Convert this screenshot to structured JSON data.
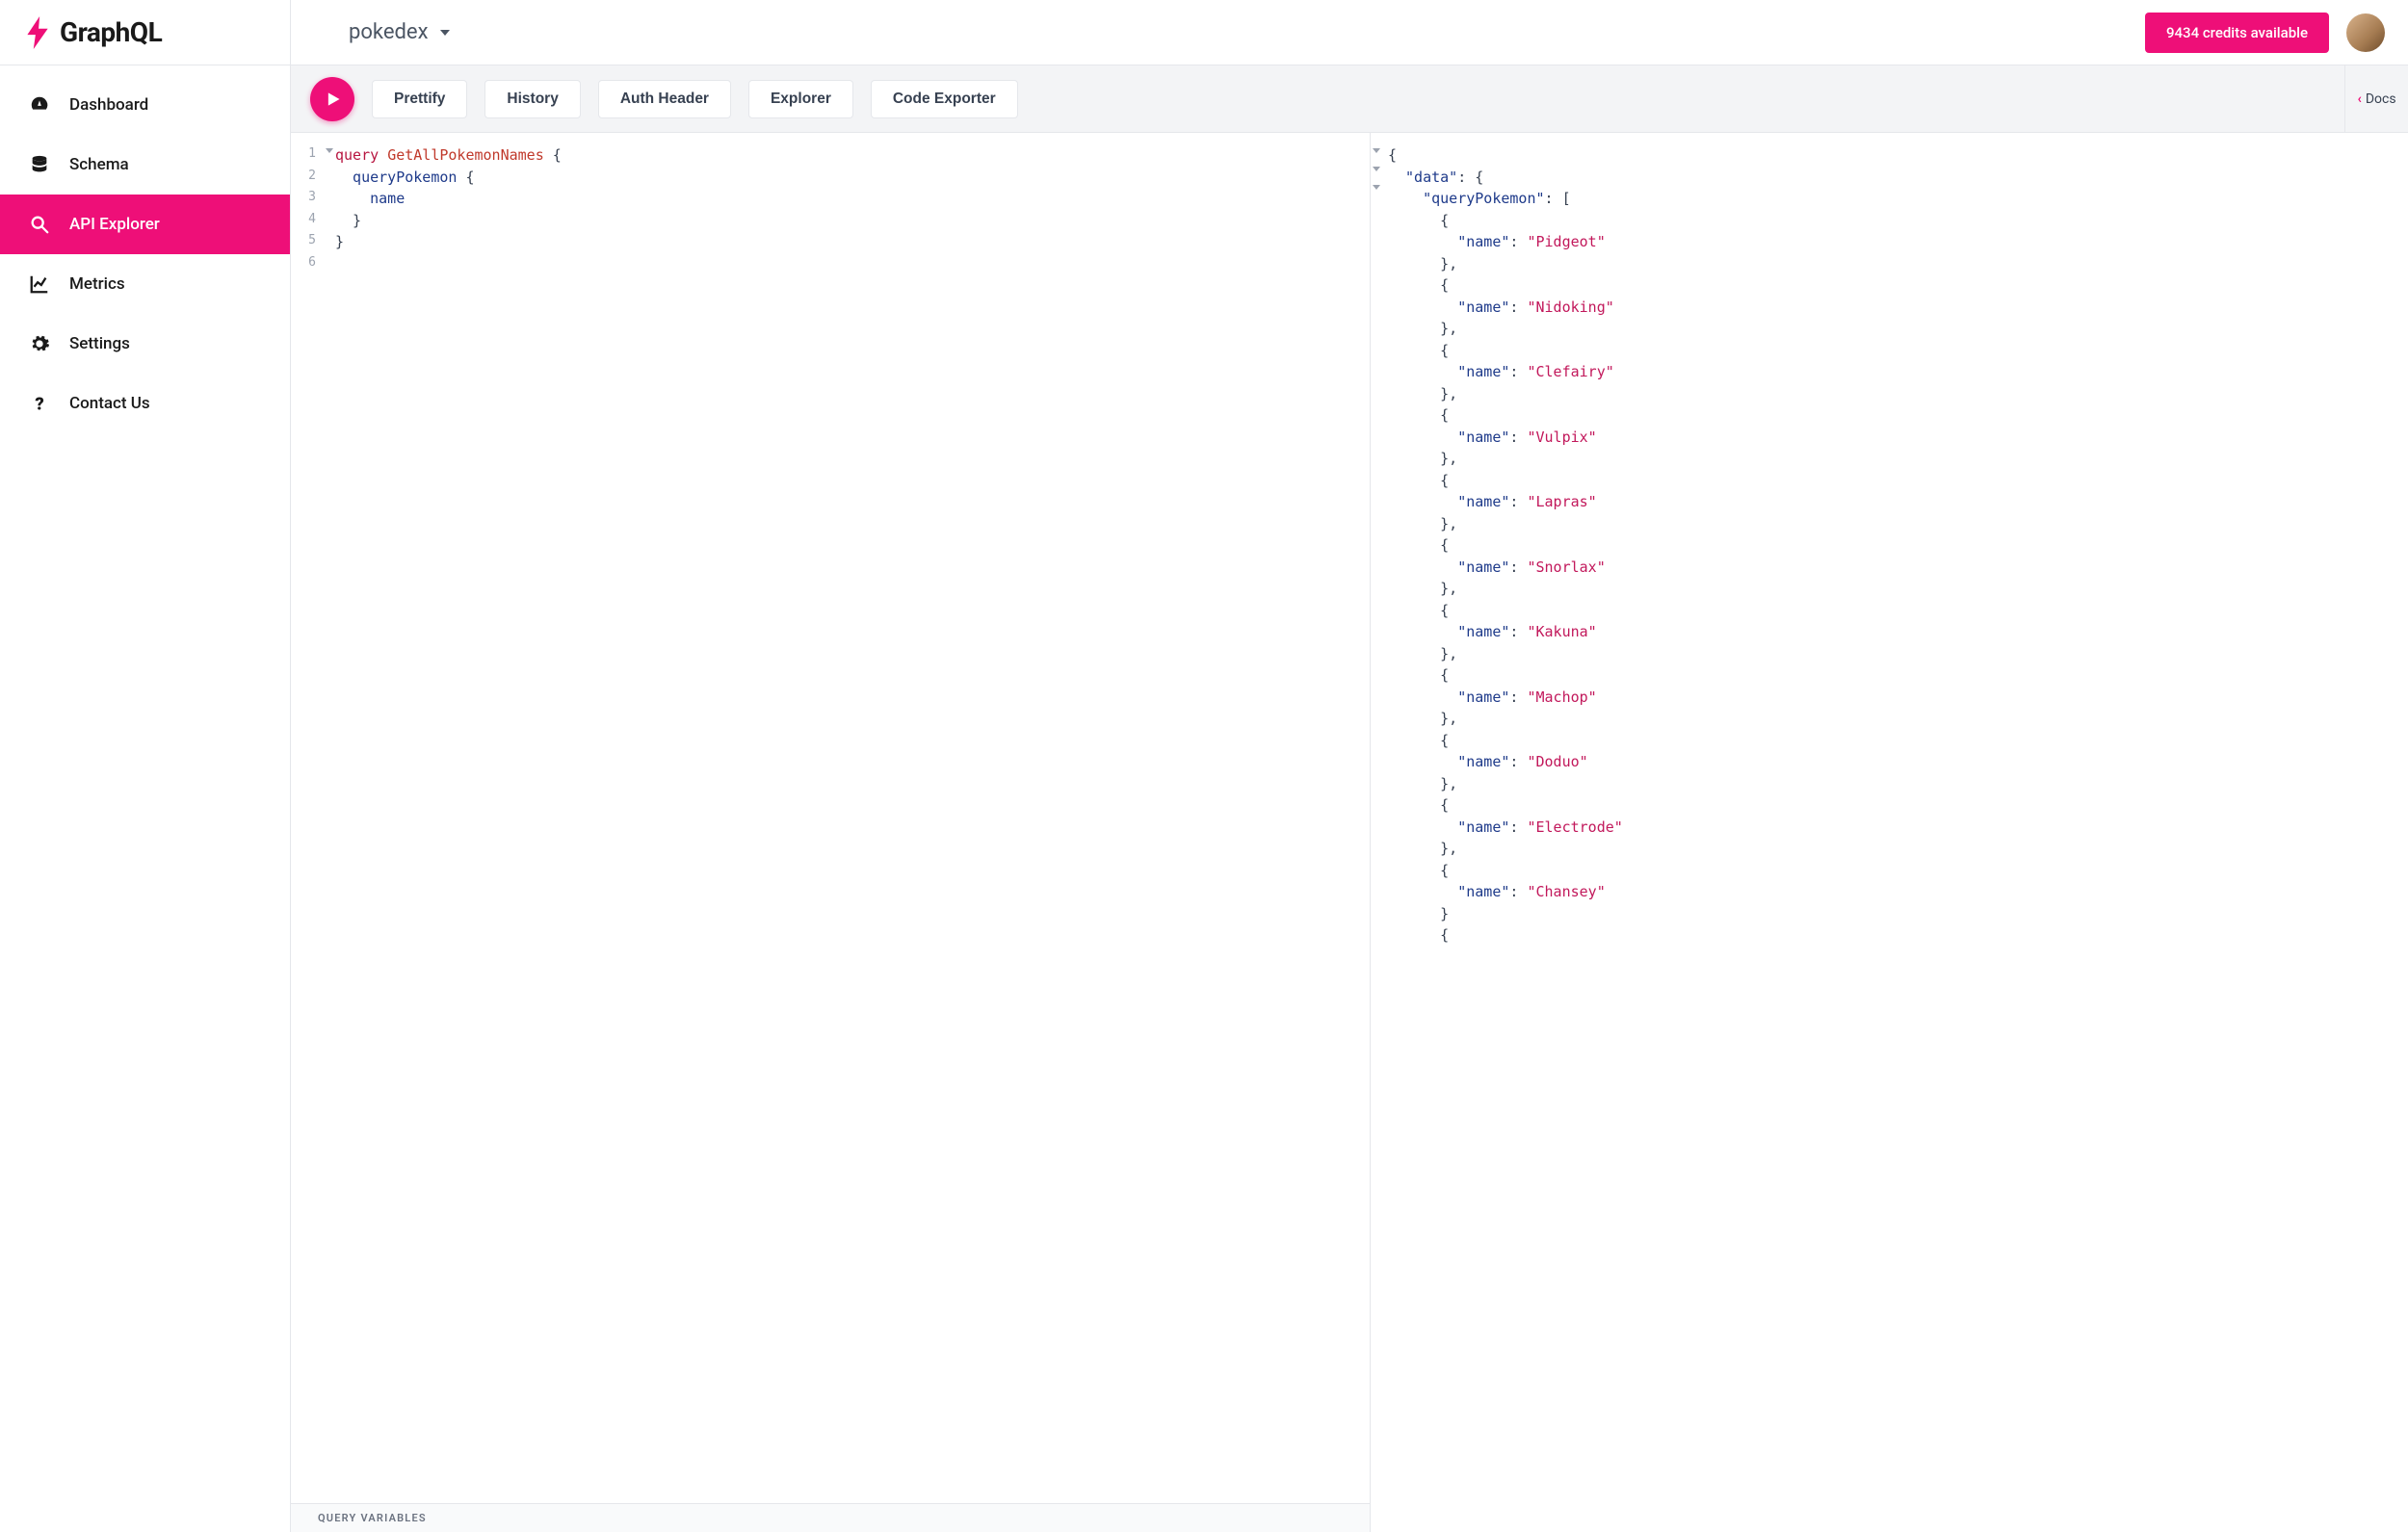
{
  "brand": "GraphQL",
  "sidebar": {
    "items": [
      {
        "label": "Dashboard",
        "icon": "dashboard-icon"
      },
      {
        "label": "Schema",
        "icon": "database-icon"
      },
      {
        "label": "API Explorer",
        "icon": "search-icon",
        "active": true
      },
      {
        "label": "Metrics",
        "icon": "chart-icon"
      },
      {
        "label": "Settings",
        "icon": "gears-icon"
      },
      {
        "label": "Contact Us",
        "icon": "help-icon"
      }
    ]
  },
  "topbar": {
    "dataset": "pokedex",
    "credits_label": "9434 credits available"
  },
  "toolbar": {
    "prettify": "Prettify",
    "history": "History",
    "auth_header": "Auth Header",
    "explorer": "Explorer",
    "code_exporter": "Code Exporter",
    "docs": "Docs"
  },
  "editor": {
    "lines": [
      {
        "n": 1,
        "fold": true,
        "tokens": [
          [
            "kw",
            "query "
          ],
          [
            "def",
            "GetAllPokemonNames"
          ],
          [
            "brace",
            " {"
          ]
        ]
      },
      {
        "n": 2,
        "fold": false,
        "tokens": [
          [
            "fld",
            "  queryPokemon"
          ],
          [
            "brace",
            " {"
          ]
        ]
      },
      {
        "n": 3,
        "fold": false,
        "tokens": [
          [
            "fld",
            "    name"
          ]
        ]
      },
      {
        "n": 4,
        "fold": false,
        "tokens": [
          [
            "brace",
            "  }"
          ]
        ]
      },
      {
        "n": 5,
        "fold": false,
        "tokens": [
          [
            "brace",
            "}"
          ]
        ]
      },
      {
        "n": 6,
        "fold": false,
        "tokens": []
      }
    ],
    "query_variables_label": "QUERY VARIABLES"
  },
  "result": {
    "data_key": "data",
    "list_key": "queryPokemon",
    "item_key": "name",
    "items": [
      "Pidgeot",
      "Nidoking",
      "Clefairy",
      "Vulpix",
      "Lapras",
      "Snorlax",
      "Kakuna",
      "Machop",
      "Doduo",
      "Electrode",
      "Chansey"
    ]
  }
}
